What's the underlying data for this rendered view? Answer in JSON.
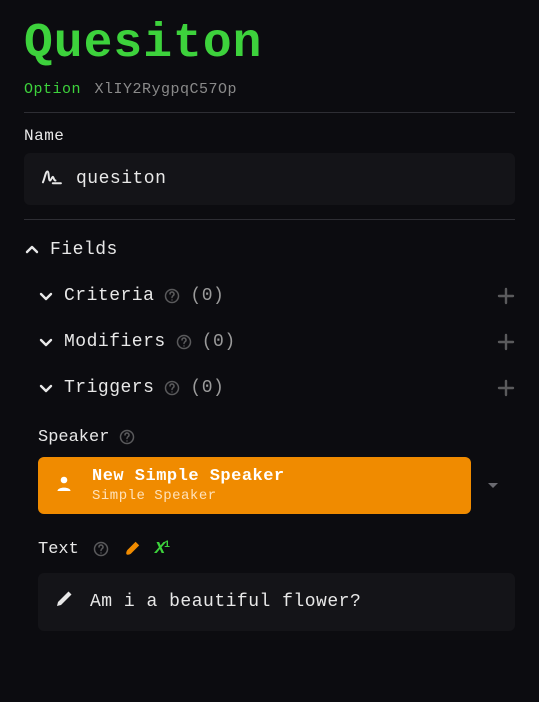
{
  "title": "Quesiton",
  "subtitle": {
    "label": "Option",
    "id": "XlIY2RygpqC57Op"
  },
  "name": {
    "label": "Name",
    "value": "quesiton"
  },
  "fields": {
    "label": "Fields"
  },
  "groups": {
    "criteria": {
      "label": "Criteria",
      "count": "(0)"
    },
    "modifiers": {
      "label": "Modifiers",
      "count": "(0)"
    },
    "triggers": {
      "label": "Triggers",
      "count": "(0)"
    }
  },
  "speaker": {
    "label": "Speaker",
    "name": "New Simple Speaker",
    "type": "Simple Speaker"
  },
  "text": {
    "label": "Text",
    "value": "Am i a beautiful flower?"
  }
}
